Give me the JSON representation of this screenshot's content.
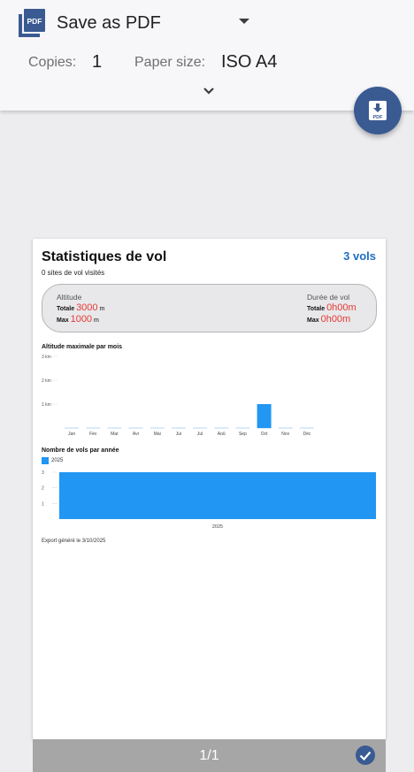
{
  "print_panel": {
    "destination": "Save as PDF",
    "copies_label": "Copies:",
    "copies_value": "1",
    "paper_label": "Paper size:",
    "paper_value": "ISO A4"
  },
  "document": {
    "title": "Statistiques de vol",
    "flights": "3 vols",
    "subtitle": "0 sites de vol visités",
    "altitude": {
      "heading": "Altitude",
      "total_label": "Totale",
      "total_value": "3000",
      "max_label": "Max",
      "max_value": "1000",
      "unit": "m"
    },
    "duration": {
      "heading": "Durée de vol",
      "total_label": "Totale",
      "total_value": "0h00m",
      "max_label": "Max",
      "max_value": "0h00m"
    },
    "export_note": "Export généré le 3/10/2025"
  },
  "chart_data": [
    {
      "type": "bar",
      "title": "Altitude maximale par mois",
      "categories": [
        "Jan",
        "Fév",
        "Mar",
        "Avr",
        "Mai",
        "Jui",
        "Jul",
        "Aoû",
        "Sep",
        "Oct",
        "Nov",
        "Déc"
      ],
      "values": [
        0,
        0,
        0,
        0,
        0,
        0,
        0,
        0,
        0,
        1,
        0,
        0
      ],
      "yticks": [
        "1 km",
        "2 km",
        "3 km"
      ],
      "ylim": [
        0,
        3
      ],
      "color": "#2196f3"
    },
    {
      "type": "bar",
      "title": "Nombre de vols par année",
      "categories": [
        "2025"
      ],
      "series": [
        {
          "name": "2025",
          "values": [
            3
          ]
        }
      ],
      "yticks": [
        "1",
        "2",
        "3"
      ],
      "ylim": [
        0,
        3
      ],
      "color": "#2196f3"
    }
  ],
  "footer": {
    "page_count": "1/1"
  }
}
